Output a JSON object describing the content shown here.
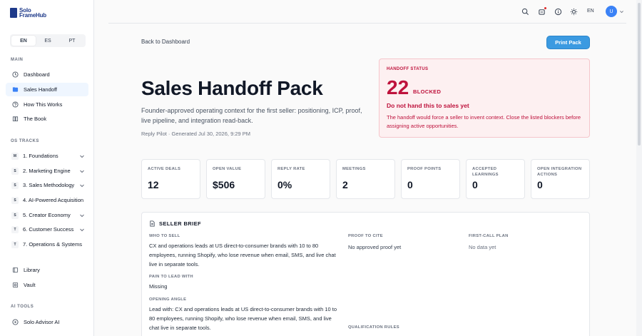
{
  "brand": {
    "line1": "Solo",
    "line2": "FrameHub"
  },
  "sidebar": {
    "languages": [
      "EN",
      "ES",
      "PT"
    ],
    "main_label": "MAIN",
    "main_items": [
      {
        "label": "Dashboard",
        "icon": "clock-icon"
      },
      {
        "label": "Sales Handoff",
        "icon": "folder-icon"
      },
      {
        "label": "How This Works",
        "icon": "question-icon"
      },
      {
        "label": "The Book",
        "icon": "book-icon"
      }
    ],
    "tracks_label": "OS TRACKS",
    "tracks": [
      {
        "badge": "M",
        "label": "1. Foundations"
      },
      {
        "badge": "S",
        "label": "2. Marketing Engine"
      },
      {
        "badge": "S",
        "label": "3. Sales Methodology"
      },
      {
        "badge": "S",
        "label": "4. AI-Powered Acquisition"
      },
      {
        "badge": "S",
        "label": "5. Creator Economy"
      },
      {
        "badge": "T",
        "label": "6. Customer Success"
      },
      {
        "badge": "T",
        "label": "7. Operations & Systems"
      }
    ],
    "extra_items": [
      {
        "label": "Library"
      },
      {
        "label": "Vault"
      }
    ],
    "ai_label": "AI TOOLS",
    "ai_items": [
      {
        "label": "Solo Advisor AI"
      }
    ]
  },
  "topbar": {
    "lang": "EN",
    "avatar": "U"
  },
  "main": {
    "back": "Back to Dashboard",
    "print": "Print Pack",
    "title": "Sales Handoff Pack",
    "description": "Founder-approved operating context for the first seller: positioning, ICP, proof, live pipeline, and integration read-back.",
    "meta": "Reply Pilot · Generated Jul 30, 2026, 9:29 PM"
  },
  "status": {
    "label": "HANDOFF STATUS",
    "number": "22",
    "word": "BLOCKED",
    "headline": "Do not hand this to sales yet",
    "body": "The handoff would force a seller to invent context. Close the listed blockers before assigning active opportunities.",
    "color": "#be123c"
  },
  "metrics": [
    {
      "label": "ACTIVE DEALS",
      "value": "12"
    },
    {
      "label": "OPEN VALUE",
      "value": "$506"
    },
    {
      "label": "REPLY RATE",
      "value": "0%"
    },
    {
      "label": "MEETINGS",
      "value": "2"
    },
    {
      "label": "PROOF POINTS",
      "value": "0"
    },
    {
      "label": "ACCEPTED LEARNINGS",
      "value": "0"
    },
    {
      "label": "OPEN INTEGRATION ACTIONS",
      "value": "0"
    }
  ],
  "brief": {
    "title": "SELLER BRIEF",
    "who_label": "WHO TO SELL",
    "who_value": "CX and operations leads at US direct-to-consumer brands with 10 to 80 employees, running Shopify, who lose revenue when email, SMS, and live chat live in separate tools.",
    "pain_label": "PAIN TO LEAD WITH",
    "pain_value": "Missing",
    "opening_label": "OPENING ANGLE",
    "opening_value": "Lead with: CX and operations leads at US direct-to-consumer brands with 10 to 80 employees, running Shopify, who lose revenue when email, SMS, and live chat live in separate tools.",
    "proof_label": "PROOF TO CITE",
    "proof_value": "No approved proof yet",
    "qual_label": "QUALIFICATION RULES",
    "call_label": "FIRST-CALL PLAN",
    "call_value": "No data yet"
  }
}
